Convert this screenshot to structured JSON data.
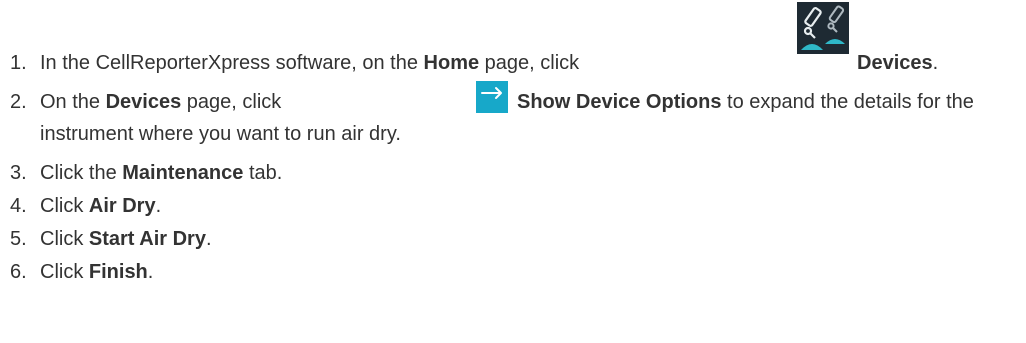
{
  "steps": [
    {
      "number": "1.",
      "text_a": "In the CellReporterXpress software, on the ",
      "bold_a": "Home",
      "text_b": " page, click ",
      "icon": "microscopes-devices-icon",
      "bold_b": "Devices",
      "text_c": "."
    },
    {
      "number": "2.",
      "text_a": "On the ",
      "bold_a": "Devices",
      "text_b": " page, click ",
      "icon": "right-arrow-icon",
      "bold_b": "Show Device Options",
      "text_c": " to expand the details for the",
      "line2": "instrument where you want to run air dry."
    },
    {
      "number": "3.",
      "text_a": "Click the ",
      "bold_a": "Maintenance",
      "text_b": " tab."
    },
    {
      "number": "4.",
      "text_a": "Click ",
      "bold_a": "Air Dry",
      "text_b": "."
    },
    {
      "number": "5.",
      "text_a": "Click ",
      "bold_a": "Start Air Dry",
      "text_b": "."
    },
    {
      "number": "6.",
      "text_a": "Click ",
      "bold_a": "Finish",
      "text_b": "."
    }
  ],
  "colors": {
    "text": "#333333",
    "devices_icon_bg": "#1e2a33",
    "devices_icon_base": "#2fb8c8",
    "arrow_icon_bg": "#17a8c9"
  }
}
